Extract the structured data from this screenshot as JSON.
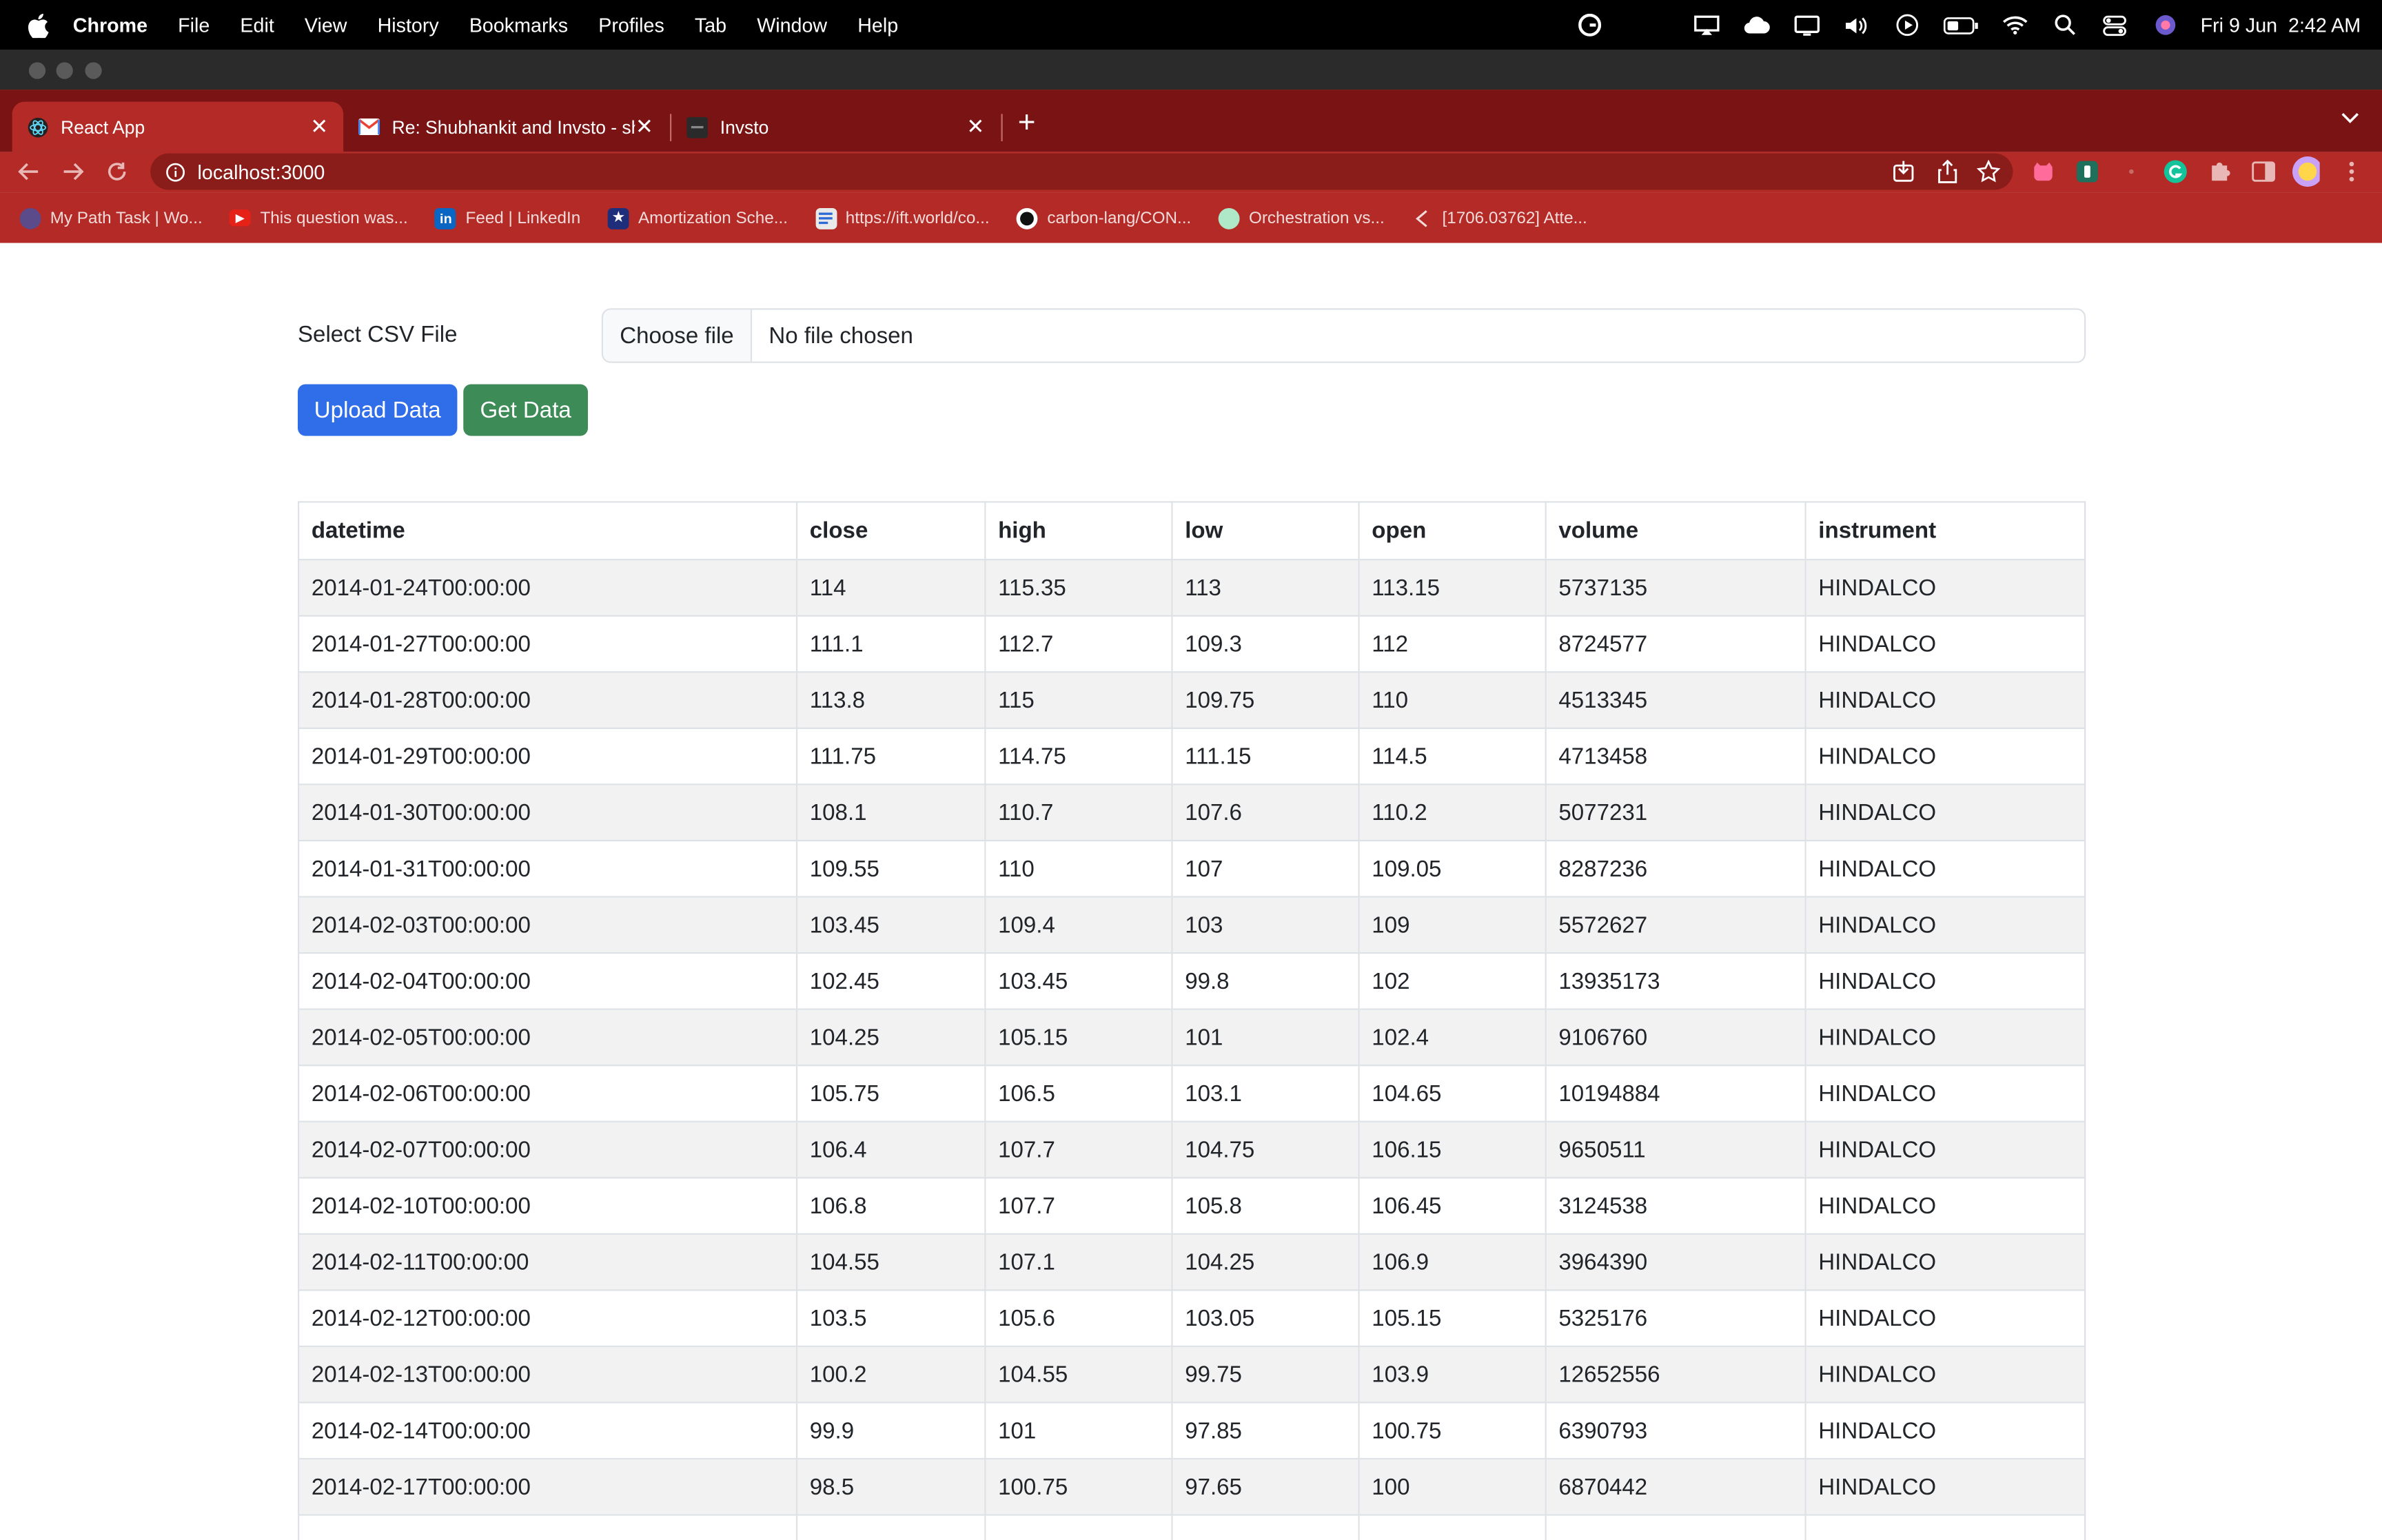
{
  "menubar": {
    "app": "Chrome",
    "items": [
      "File",
      "Edit",
      "View",
      "History",
      "Bookmarks",
      "Profiles",
      "Tab",
      "Window",
      "Help"
    ],
    "datetime": "Fri 9 Jun  2:42 AM"
  },
  "tabs": [
    {
      "label": "React App",
      "icon": "react-icon"
    },
    {
      "label": "Re: Shubhankit and Invsto - sh",
      "icon": "gmail-icon"
    },
    {
      "label": "Invsto",
      "icon": "invsto-icon"
    }
  ],
  "omnibox": {
    "url": "localhost:3000"
  },
  "bookmarks": [
    {
      "label": "My Path Task | Wo...",
      "color": "#5b4b8a"
    },
    {
      "label": "This question was...",
      "color": "#e62117"
    },
    {
      "label": "Feed | LinkedIn",
      "color": "#0a66c2"
    },
    {
      "label": "Amortization Sche...",
      "color": "#1f2e7a"
    },
    {
      "label": "https://ift.world/co...",
      "color": "#e9e9e9"
    },
    {
      "label": "carbon-lang/CON...",
      "color": "#ffffff"
    },
    {
      "label": "Orchestration vs...",
      "color": "#aee8c8"
    },
    {
      "label": "[1706.03762] Atte...",
      "color": "#b32a26"
    }
  ],
  "form": {
    "label": "Select CSV File",
    "choose_button": "Choose file",
    "no_file": "No file chosen",
    "upload_button": "Upload Data",
    "get_button": "Get Data"
  },
  "table": {
    "columns": [
      "datetime",
      "close",
      "high",
      "low",
      "open",
      "volume",
      "instrument"
    ],
    "rows": [
      [
        "2014-01-24T00:00:00",
        "114",
        "115.35",
        "113",
        "113.15",
        "5737135",
        "HINDALCO"
      ],
      [
        "2014-01-27T00:00:00",
        "111.1",
        "112.7",
        "109.3",
        "112",
        "8724577",
        "HINDALCO"
      ],
      [
        "2014-01-28T00:00:00",
        "113.8",
        "115",
        "109.75",
        "110",
        "4513345",
        "HINDALCO"
      ],
      [
        "2014-01-29T00:00:00",
        "111.75",
        "114.75",
        "111.15",
        "114.5",
        "4713458",
        "HINDALCO"
      ],
      [
        "2014-01-30T00:00:00",
        "108.1",
        "110.7",
        "107.6",
        "110.2",
        "5077231",
        "HINDALCO"
      ],
      [
        "2014-01-31T00:00:00",
        "109.55",
        "110",
        "107",
        "109.05",
        "8287236",
        "HINDALCO"
      ],
      [
        "2014-02-03T00:00:00",
        "103.45",
        "109.4",
        "103",
        "109",
        "5572627",
        "HINDALCO"
      ],
      [
        "2014-02-04T00:00:00",
        "102.45",
        "103.45",
        "99.8",
        "102",
        "13935173",
        "HINDALCO"
      ],
      [
        "2014-02-05T00:00:00",
        "104.25",
        "105.15",
        "101",
        "102.4",
        "9106760",
        "HINDALCO"
      ],
      [
        "2014-02-06T00:00:00",
        "105.75",
        "106.5",
        "103.1",
        "104.65",
        "10194884",
        "HINDALCO"
      ],
      [
        "2014-02-07T00:00:00",
        "106.4",
        "107.7",
        "104.75",
        "106.15",
        "9650511",
        "HINDALCO"
      ],
      [
        "2014-02-10T00:00:00",
        "106.8",
        "107.7",
        "105.8",
        "106.45",
        "3124538",
        "HINDALCO"
      ],
      [
        "2014-02-11T00:00:00",
        "104.55",
        "107.1",
        "104.25",
        "106.9",
        "3964390",
        "HINDALCO"
      ],
      [
        "2014-02-12T00:00:00",
        "103.5",
        "105.6",
        "103.05",
        "105.15",
        "5325176",
        "HINDALCO"
      ],
      [
        "2014-02-13T00:00:00",
        "100.2",
        "104.55",
        "99.75",
        "103.9",
        "12652556",
        "HINDALCO"
      ],
      [
        "2014-02-14T00:00:00",
        "99.9",
        "101",
        "97.85",
        "100.75",
        "6390793",
        "HINDALCO"
      ],
      [
        "2014-02-17T00:00:00",
        "98.5",
        "100.75",
        "97.65",
        "100",
        "6870442",
        "HINDALCO"
      ],
      [
        "",
        "",
        "",
        "",
        "",
        "",
        ""
      ]
    ]
  }
}
